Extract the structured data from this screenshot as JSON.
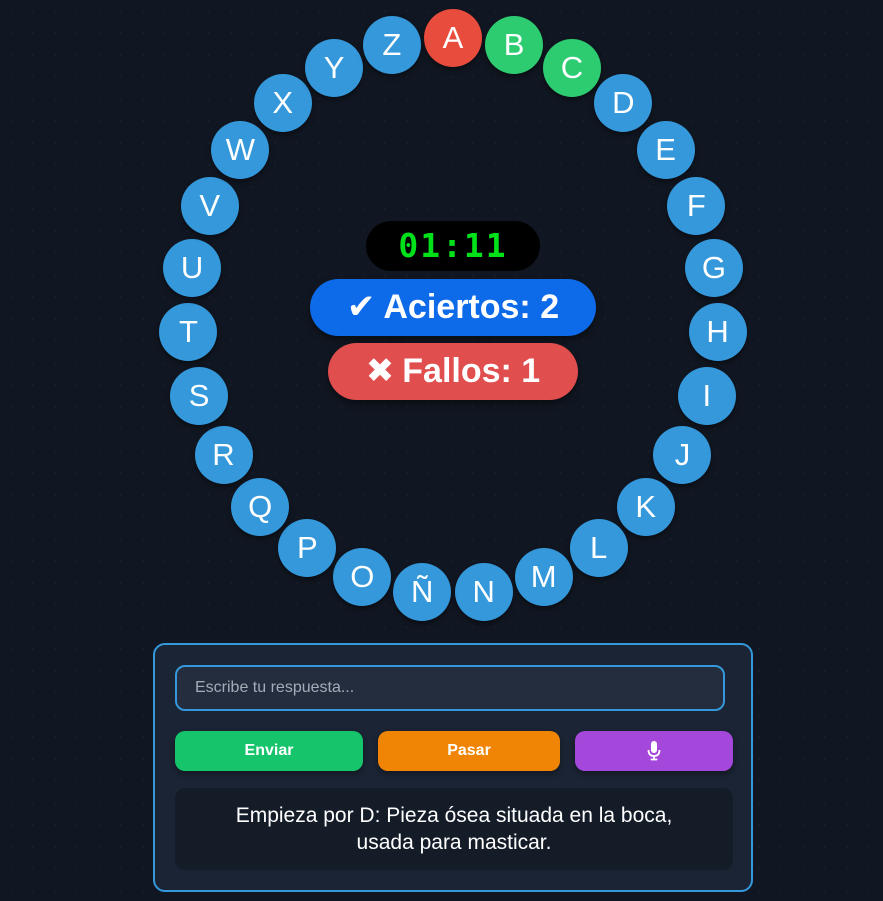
{
  "letters": [
    {
      "label": "A",
      "status": "wrong"
    },
    {
      "label": "B",
      "status": "correct"
    },
    {
      "label": "C",
      "status": "correct"
    },
    {
      "label": "D",
      "status": "pending"
    },
    {
      "label": "E",
      "status": "pending"
    },
    {
      "label": "F",
      "status": "pending"
    },
    {
      "label": "G",
      "status": "pending"
    },
    {
      "label": "H",
      "status": "pending"
    },
    {
      "label": "I",
      "status": "pending"
    },
    {
      "label": "J",
      "status": "pending"
    },
    {
      "label": "K",
      "status": "pending"
    },
    {
      "label": "L",
      "status": "pending"
    },
    {
      "label": "M",
      "status": "pending"
    },
    {
      "label": "N",
      "status": "pending"
    },
    {
      "label": "Ñ",
      "status": "pending"
    },
    {
      "label": "O",
      "status": "pending"
    },
    {
      "label": "P",
      "status": "pending"
    },
    {
      "label": "Q",
      "status": "pending"
    },
    {
      "label": "R",
      "status": "pending"
    },
    {
      "label": "S",
      "status": "pending"
    },
    {
      "label": "T",
      "status": "pending"
    },
    {
      "label": "U",
      "status": "pending"
    },
    {
      "label": "V",
      "status": "pending"
    },
    {
      "label": "W",
      "status": "pending"
    },
    {
      "label": "X",
      "status": "pending"
    },
    {
      "label": "Y",
      "status": "pending"
    },
    {
      "label": "Z",
      "status": "pending"
    }
  ],
  "colors": {
    "pending": "#3498db",
    "correct": "#2ecc71",
    "wrong": "#e74c3c",
    "timer": "#00e11a"
  },
  "timer": "01:11",
  "score": {
    "correct_icon": "✔",
    "correct_text": "Aciertos: 2",
    "wrong_icon": "✖",
    "wrong_text": "Fallos: 1"
  },
  "input": {
    "placeholder": "Escribe tu respuesta...",
    "value": ""
  },
  "buttons": {
    "send_label": "Enviar",
    "pass_label": "Pasar",
    "mic_icon": "microphone-icon"
  },
  "clue": "Empieza por D: Pieza ósea situada en la boca, usada para masticar."
}
